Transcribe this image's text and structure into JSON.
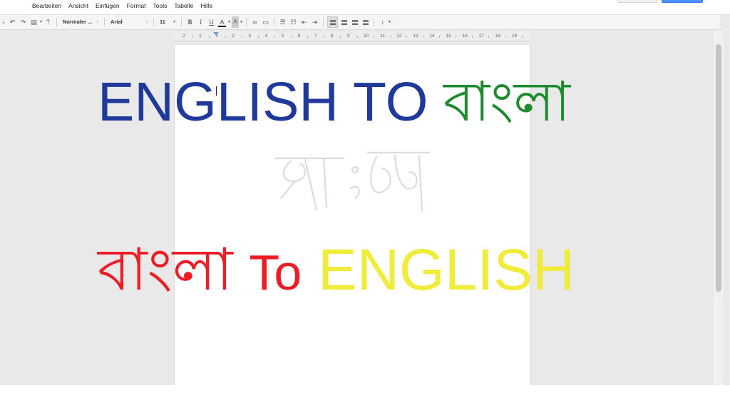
{
  "menubar": {
    "items": [
      "Bearbeiten",
      "Ansicht",
      "Einfügen",
      "Format",
      "Tools",
      "Tabelle",
      "Hilfe"
    ]
  },
  "toolbar": {
    "style_value": "Normaler ...",
    "font_value": "Arial",
    "size_value": "11",
    "bold_label": "B",
    "italic_label": "I",
    "underline_label": "U",
    "text_color_label": "A",
    "highlight_label": "A",
    "icons": [
      "undo-icon",
      "redo-icon",
      "print-icon",
      "paint-format-icon",
      "link-icon",
      "comment-icon",
      "numbered-list-icon",
      "bulleted-list-icon",
      "decrease-indent-icon",
      "increase-indent-icon",
      "align-left-icon",
      "align-center-icon",
      "align-right-icon",
      "justify-icon",
      "line-spacing-icon"
    ]
  },
  "ruler": {
    "numbers": [
      "2",
      "1",
      "1",
      "2",
      "3",
      "4",
      "5",
      "6",
      "7",
      "8",
      "9",
      "10",
      "11",
      "12",
      "13",
      "14",
      "15",
      "16",
      "17",
      "18",
      "19"
    ]
  },
  "overlay": {
    "line1": {
      "english": "ENGLISH TO",
      "bangla": "বাংলা"
    },
    "line3": {
      "bangla": "বাংলা",
      "to": "To",
      "english": "ENGLISH"
    }
  },
  "colors": {
    "blue": "#1f3a9a",
    "green": "#1e8c2e",
    "red": "#ee1c25",
    "yellow": "#f0ec3c",
    "accent_button": "#4d90fe"
  }
}
